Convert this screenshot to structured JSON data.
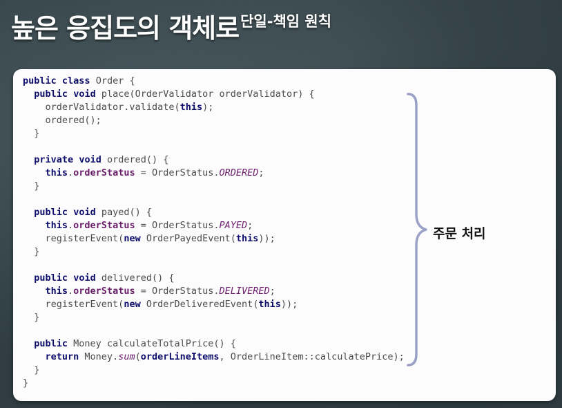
{
  "title": {
    "main": "높은 응집도의 객체로",
    "sub": "단일-책임 원칙"
  },
  "code": {
    "line1_kw1": "public",
    "line1_kw2": "class",
    "line1_rest": " Order {",
    "place_kw1": "public",
    "place_kw2": "void",
    "place_sig": " place(OrderValidator orderValidator) {",
    "place_b1a": "orderValidator.validate(",
    "place_b1_this": "this",
    "place_b1b": ");",
    "place_b2": "ordered();",
    "close_brace": "}",
    "ordered_kw1": "private",
    "ordered_kw2": "void",
    "ordered_sig": " ordered() {",
    "this_kw": "this",
    "dot": ".",
    "order_status": "orderStatus",
    "assign_prefix": " = OrderStatus.",
    "ordered_const": "ORDERED",
    "semicolon": ";",
    "payed_kw1": "public",
    "payed_kw2": "void",
    "payed_sig": " payed() {",
    "payed_const": "PAYED",
    "register_prefix": "registerEvent(",
    "new_kw": "new",
    "payed_event": " OrderPayedEvent(",
    "event_suffix": "));",
    "delivered_kw1": "public",
    "delivered_kw2": "void",
    "delivered_sig": " delivered() {",
    "delivered_const": "DELIVERED",
    "delivered_event": " OrderDeliveredEvent(",
    "calc_kw1": "public",
    "calc_sig": " Money calculateTotalPrice() {",
    "return_kw": "return",
    "money_prefix": " Money.",
    "sum_fn": "sum",
    "paren_open": "(",
    "order_line_items": "orderLineItems",
    "calc_rest": ", OrderLineItem::calculatePrice);"
  },
  "side_label": "주문 처리"
}
